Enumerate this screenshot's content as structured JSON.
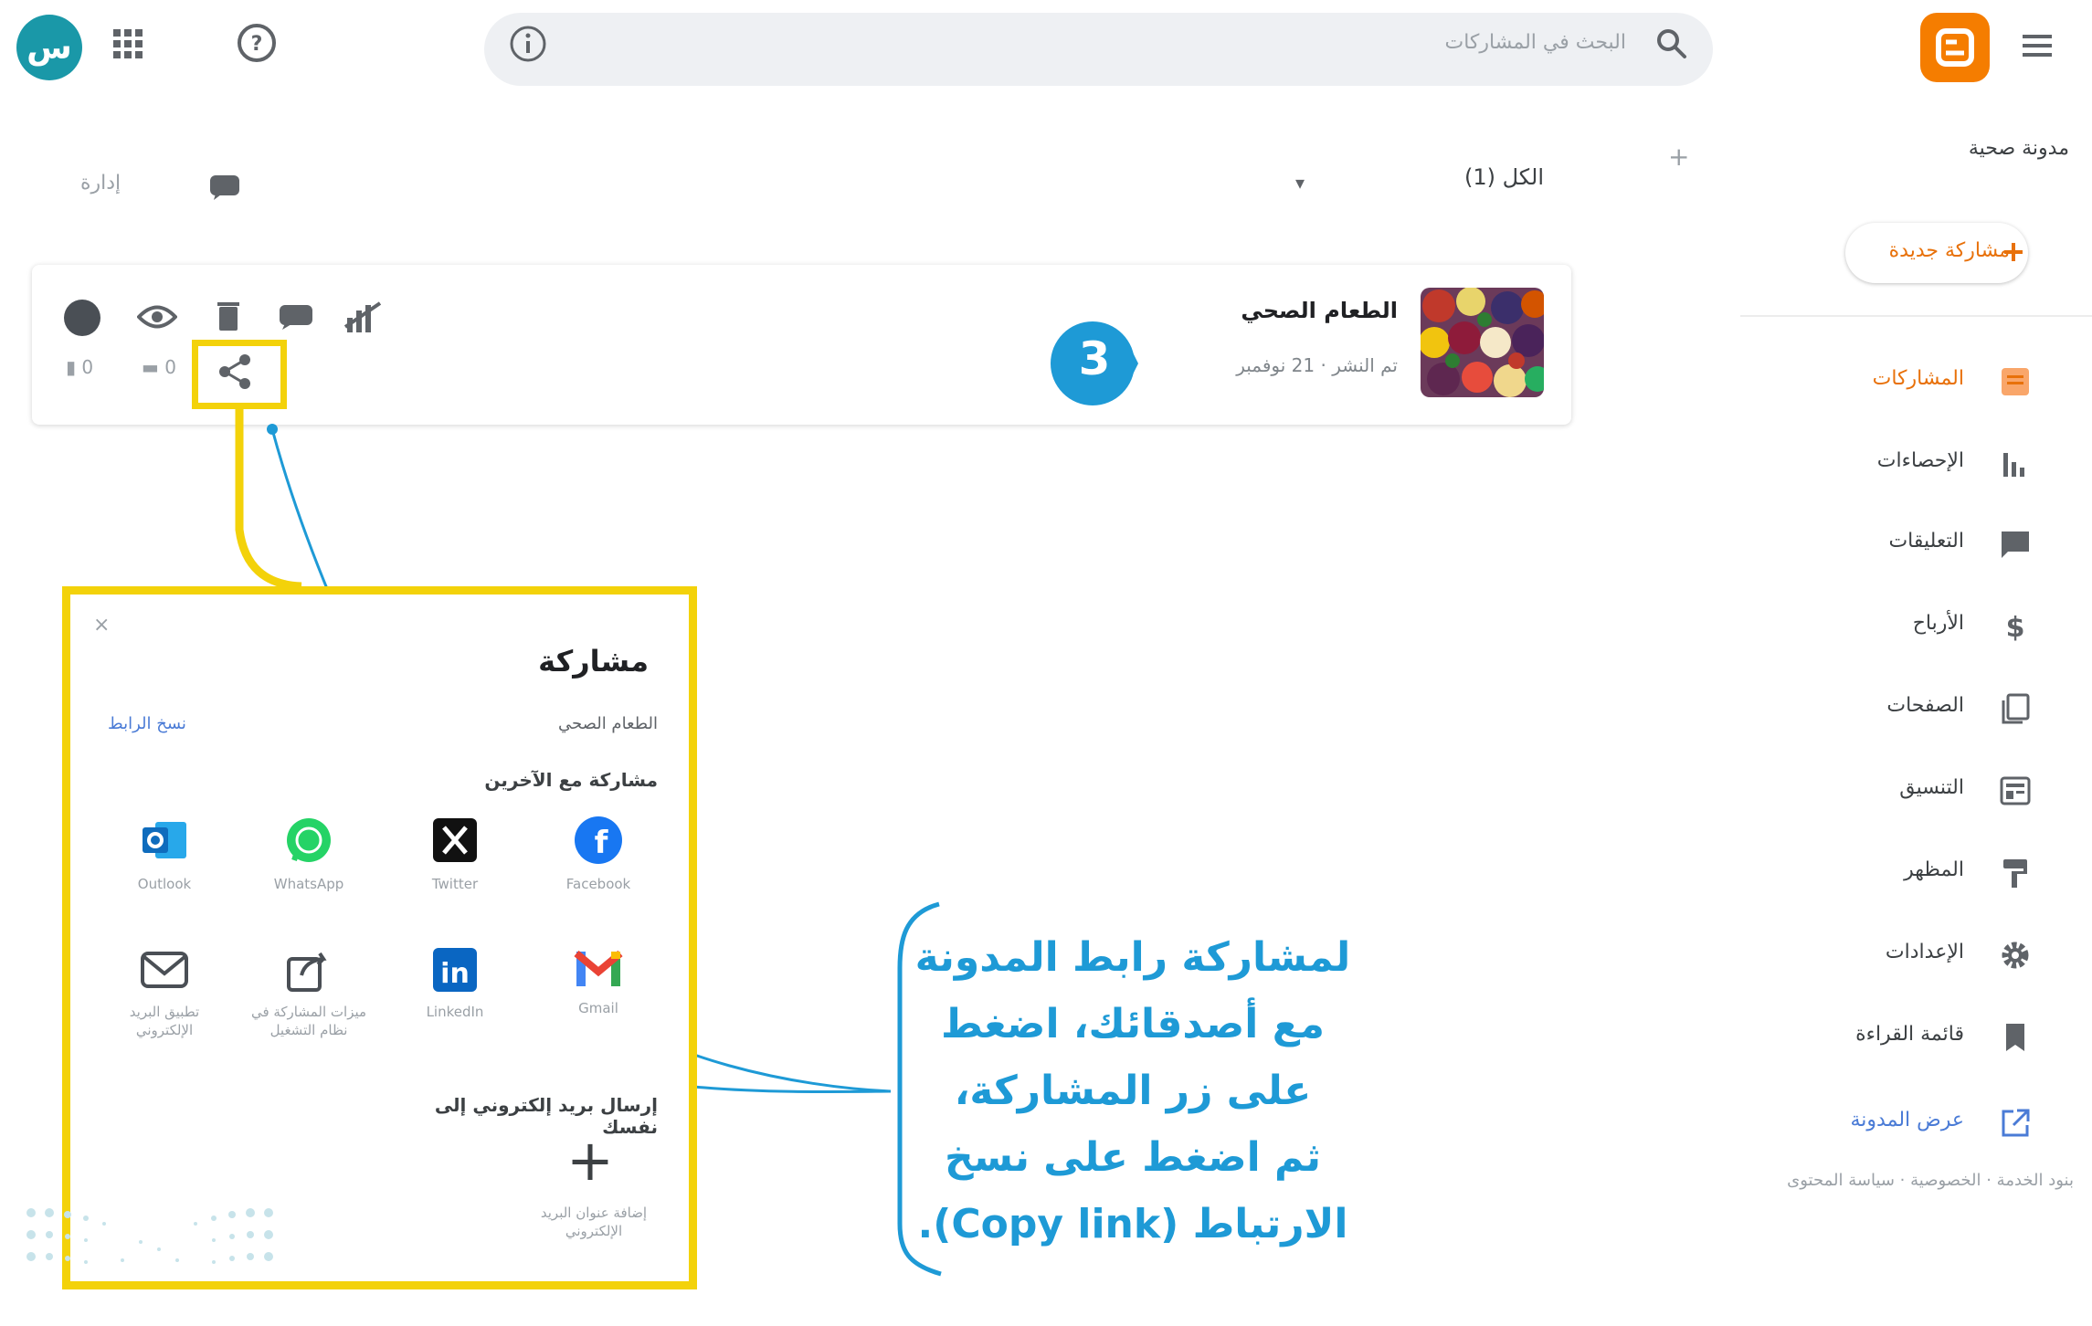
{
  "topbar": {
    "search_placeholder": "البحث في المشاركات",
    "avatar_letter": "س"
  },
  "sidebar": {
    "new_post_label": "مدونة صحية",
    "new_post_button": "مشاركة جديدة",
    "items": [
      {
        "label": "المشاركات",
        "icon": "posts-icon",
        "active": true
      },
      {
        "label": "الإحصاءات",
        "icon": "stats-icon"
      },
      {
        "label": "التعليقات",
        "icon": "comments-icon"
      },
      {
        "label": "الأرباح",
        "icon": "earnings-icon"
      },
      {
        "label": "الصفحات",
        "icon": "pages-icon"
      },
      {
        "label": "التنسيق",
        "icon": "layout-icon"
      },
      {
        "label": "المظهر",
        "icon": "theme-icon"
      },
      {
        "label": "الإعدادات",
        "icon": "settings-icon"
      },
      {
        "label": "قائمة القراءة",
        "icon": "reading-list-icon"
      },
      {
        "label": "عرض المدونة",
        "icon": "view-blog-icon"
      }
    ],
    "footer": "بنود الخدمة · الخصوصية · سياسة المحتوى"
  },
  "posts_header": {
    "filter_label": "الكل (1)",
    "manage_label": "إدارة"
  },
  "post": {
    "title": "الطعام الصحي",
    "meta": "تم النشر · 21 نوفمبر",
    "views": "0",
    "comments": "0"
  },
  "step_number": "3",
  "share_dialog": {
    "title": "مشاركة",
    "close": "×",
    "post_name": "الطعام الصحي",
    "copy_link": "نسخ الرابط",
    "share_with_label": "مشاركة مع الآخرين",
    "services": [
      {
        "label": "Facebook",
        "icon": "facebook-icon"
      },
      {
        "label": "Twitter",
        "icon": "x-twitter-icon"
      },
      {
        "label": "WhatsApp",
        "icon": "whatsapp-icon"
      },
      {
        "label": "Outlook",
        "icon": "outlook-icon"
      },
      {
        "label": "Gmail",
        "icon": "gmail-icon"
      },
      {
        "label": "LinkedIn",
        "icon": "linkedin-icon"
      },
      {
        "label": "ميزات المشاركة في نظام التشغيل",
        "icon": "os-share-icon"
      },
      {
        "label": "تطبيق البريد الإلكتروني",
        "icon": "email-app-icon"
      }
    ],
    "email_self_label": "إرسال بريد إلكتروني إلى نفسك",
    "add_email_label": "إضافة عنوان البريد الإلكتروني"
  },
  "annotation_lines": [
    "لمشاركة رابط المدونة",
    "مع أصدقائك، اضغط",
    "على زر المشاركة،",
    "ثم اضغط على نسخ",
    "الارتباط (Copy link)."
  ],
  "colors": {
    "highlight": "#f3d20a",
    "annotation": "#1e9ad6",
    "blogger_orange": "#f57d00",
    "avatar": "#1a98a8"
  }
}
